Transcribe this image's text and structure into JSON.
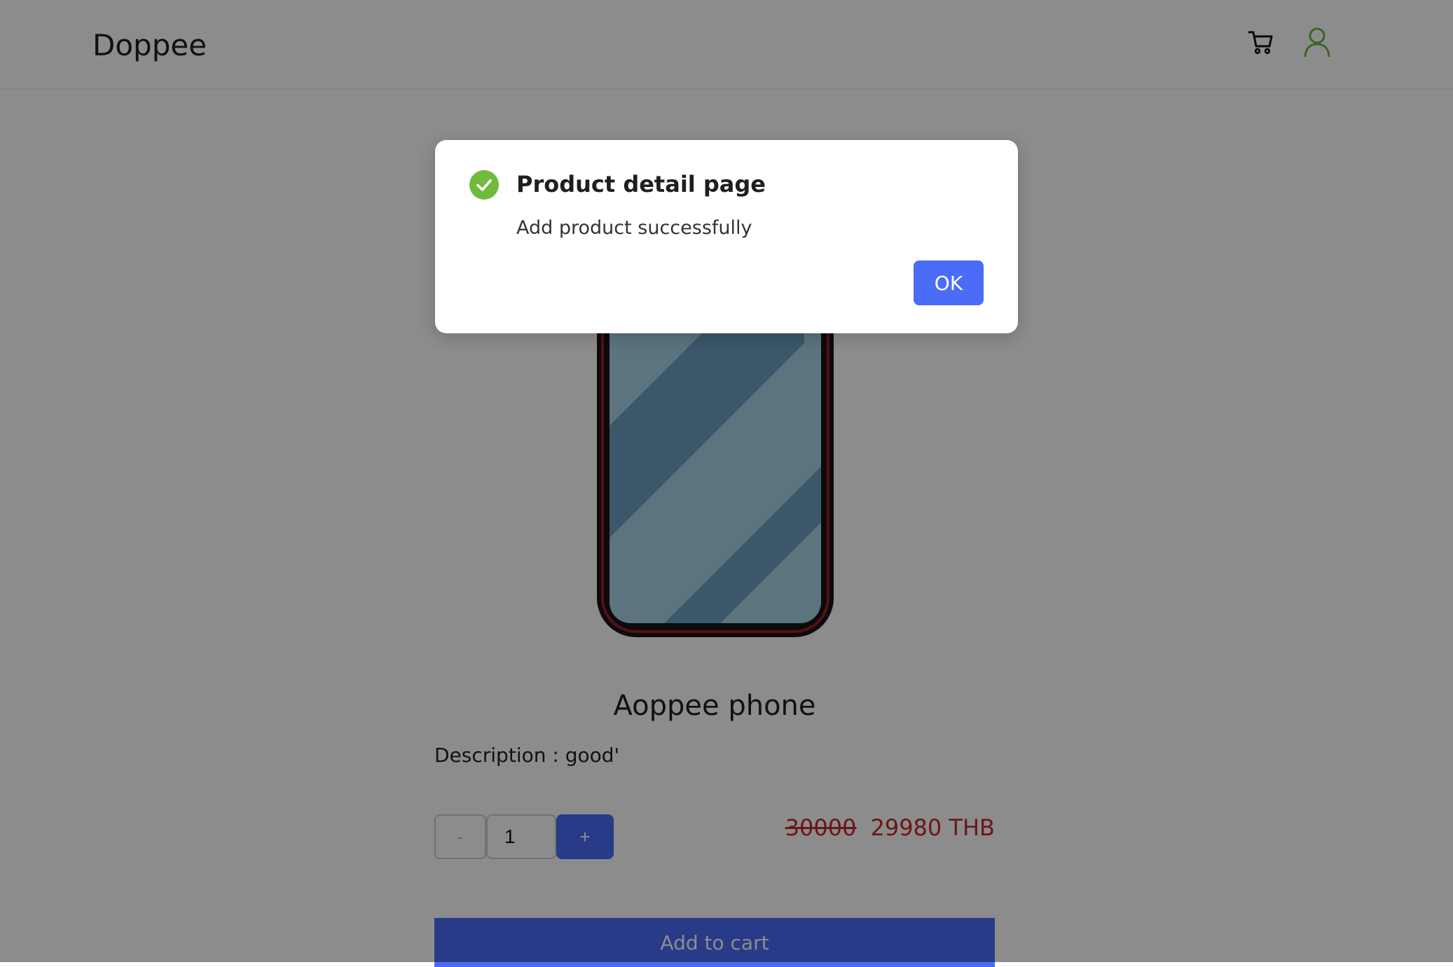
{
  "header": {
    "brand": "Doppee",
    "cart_icon": "cart-icon",
    "user_icon": "user-icon"
  },
  "product": {
    "name": "Aoppee phone",
    "description": "Description : good'",
    "quantity": "1",
    "minus_label": "-",
    "plus_label": "+",
    "old_price": "30000",
    "new_price": "29980 THB",
    "add_to_cart_label": "Add to cart"
  },
  "modal": {
    "title": "Product detail page",
    "message": "Add product successfully",
    "ok_label": "OK",
    "icon": "check-circle-icon"
  },
  "colors": {
    "accent": "#4a6cf7",
    "success": "#6fbb3e",
    "price": "#c3282b"
  }
}
